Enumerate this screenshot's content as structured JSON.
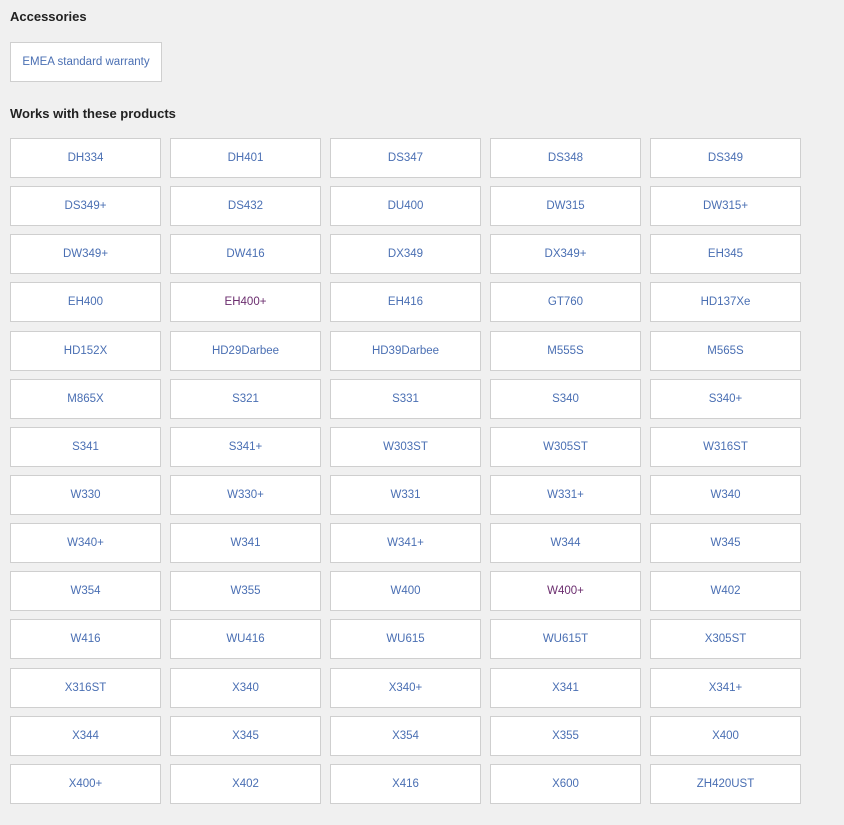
{
  "accessories": {
    "title": "Accessories",
    "items": [
      {
        "label": "EMEA standard warranty"
      }
    ]
  },
  "works_with": {
    "title": "Works with these products",
    "products": [
      {
        "label": "DH334"
      },
      {
        "label": "DH401"
      },
      {
        "label": "DS347"
      },
      {
        "label": "DS348"
      },
      {
        "label": "DS349"
      },
      {
        "label": "DS349+"
      },
      {
        "label": "DS432"
      },
      {
        "label": "DU400"
      },
      {
        "label": "DW315"
      },
      {
        "label": "DW315+"
      },
      {
        "label": "DW349+"
      },
      {
        "label": "DW416"
      },
      {
        "label": "DX349"
      },
      {
        "label": "DX349+"
      },
      {
        "label": "EH345"
      },
      {
        "label": "EH400"
      },
      {
        "label": "EH400+",
        "visited": true
      },
      {
        "label": "EH416"
      },
      {
        "label": "GT760"
      },
      {
        "label": "HD137Xe"
      },
      {
        "label": "HD152X"
      },
      {
        "label": "HD29Darbee"
      },
      {
        "label": "HD39Darbee"
      },
      {
        "label": "M555S"
      },
      {
        "label": "M565S"
      },
      {
        "label": "M865X"
      },
      {
        "label": "S321"
      },
      {
        "label": "S331"
      },
      {
        "label": "S340"
      },
      {
        "label": "S340+"
      },
      {
        "label": "S341"
      },
      {
        "label": "S341+"
      },
      {
        "label": "W303ST"
      },
      {
        "label": "W305ST"
      },
      {
        "label": "W316ST"
      },
      {
        "label": "W330"
      },
      {
        "label": "W330+"
      },
      {
        "label": "W331"
      },
      {
        "label": "W331+"
      },
      {
        "label": "W340"
      },
      {
        "label": "W340+"
      },
      {
        "label": "W341"
      },
      {
        "label": "W341+"
      },
      {
        "label": "W344"
      },
      {
        "label": "W345"
      },
      {
        "label": "W354"
      },
      {
        "label": "W355"
      },
      {
        "label": "W400"
      },
      {
        "label": "W400+",
        "visited": true
      },
      {
        "label": "W402"
      },
      {
        "label": "W416"
      },
      {
        "label": "WU416"
      },
      {
        "label": "WU615"
      },
      {
        "label": "WU615T"
      },
      {
        "label": "X305ST"
      },
      {
        "label": "X316ST"
      },
      {
        "label": "X340"
      },
      {
        "label": "X340+"
      },
      {
        "label": "X341"
      },
      {
        "label": "X341+"
      },
      {
        "label": "X344"
      },
      {
        "label": "X345"
      },
      {
        "label": "X354"
      },
      {
        "label": "X355"
      },
      {
        "label": "X400"
      },
      {
        "label": "X400+"
      },
      {
        "label": "X402"
      },
      {
        "label": "X416"
      },
      {
        "label": "X600"
      },
      {
        "label": "ZH420UST"
      }
    ]
  },
  "colors": {
    "background": "#f0f0f0",
    "link": "#4a6fb3",
    "link_visited": "#6b2d6e",
    "tile_border": "#cfcfcf",
    "heading": "#222222"
  }
}
